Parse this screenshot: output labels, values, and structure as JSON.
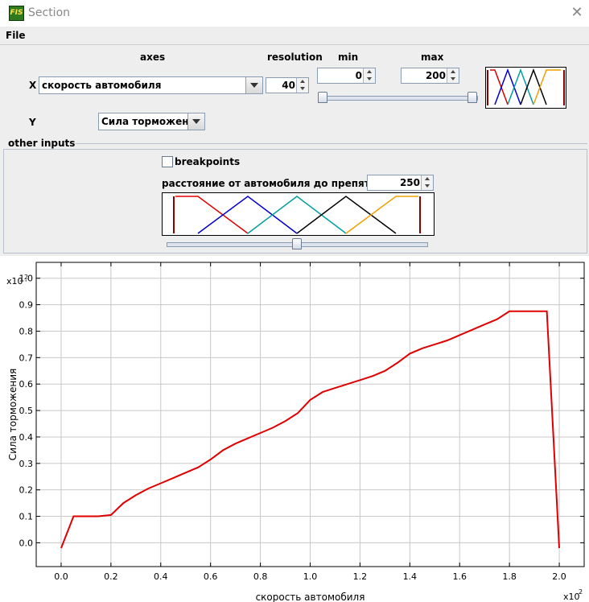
{
  "window": {
    "title": "Section",
    "icon_text": "FIS",
    "close": "✕"
  },
  "menu": {
    "file": "File"
  },
  "axes_header": {
    "axes": "axes",
    "resolution": "resolution",
    "min": "min",
    "max": "max"
  },
  "x_axis": {
    "label": "X",
    "variable": "скорость автомобиля",
    "resolution": "40",
    "min": "0",
    "max": "200",
    "slider_min": 0,
    "slider_max": 1
  },
  "y_axis": {
    "label": "Y",
    "variable": "Сила торможения"
  },
  "other_inputs": {
    "title": "other inputs",
    "breakpoints_label": "breakpoints",
    "breakpoints_checked": false,
    "input_name": "расстояние от автомобиля до препятствия",
    "input_value": "250",
    "slider_fraction": 0.5
  },
  "mf_colors": [
    "#e00000",
    "#0000cc",
    "#00a0a0",
    "#000000",
    "#f0a000"
  ],
  "chart_data": {
    "type": "line",
    "title": "",
    "xlabel": "скорость автомобиля",
    "ylabel": "Сила торможения",
    "x_multiplier": "x10",
    "x_multiplier_exp": "2",
    "y_multiplier": "x10",
    "y_multiplier_exp": "2",
    "xlim": [
      -0.1,
      2.1
    ],
    "ylim": [
      -0.09,
      1.06
    ],
    "x_ticks": [
      "0.0",
      "0.2",
      "0.4",
      "0.6",
      "0.8",
      "1.0",
      "1.2",
      "1.4",
      "1.6",
      "1.8",
      "2.0"
    ],
    "y_ticks": [
      "0.0",
      "0.1",
      "0.2",
      "0.3",
      "0.4",
      "0.5",
      "0.6",
      "0.7",
      "0.8",
      "0.9",
      "1.0"
    ],
    "grid": true,
    "series": [
      {
        "color": "#e00000",
        "x": [
          0.0,
          0.05,
          0.1,
          0.15,
          0.2,
          0.25,
          0.3,
          0.35,
          0.4,
          0.45,
          0.5,
          0.55,
          0.6,
          0.65,
          0.7,
          0.75,
          0.8,
          0.85,
          0.9,
          0.95,
          1.0,
          1.05,
          1.1,
          1.15,
          1.2,
          1.25,
          1.3,
          1.35,
          1.4,
          1.45,
          1.5,
          1.55,
          1.6,
          1.65,
          1.7,
          1.75,
          1.8,
          1.85,
          1.9,
          1.95,
          2.0
        ],
        "y": [
          -0.02,
          0.1,
          0.1,
          0.1,
          0.105,
          0.15,
          0.18,
          0.205,
          0.225,
          0.245,
          0.265,
          0.285,
          0.315,
          0.35,
          0.375,
          0.395,
          0.415,
          0.435,
          0.46,
          0.49,
          0.54,
          0.57,
          0.585,
          0.6,
          0.615,
          0.63,
          0.65,
          0.68,
          0.715,
          0.735,
          0.75,
          0.765,
          0.785,
          0.805,
          0.825,
          0.845,
          0.875,
          0.875,
          0.875,
          0.875,
          -0.02
        ]
      }
    ]
  }
}
